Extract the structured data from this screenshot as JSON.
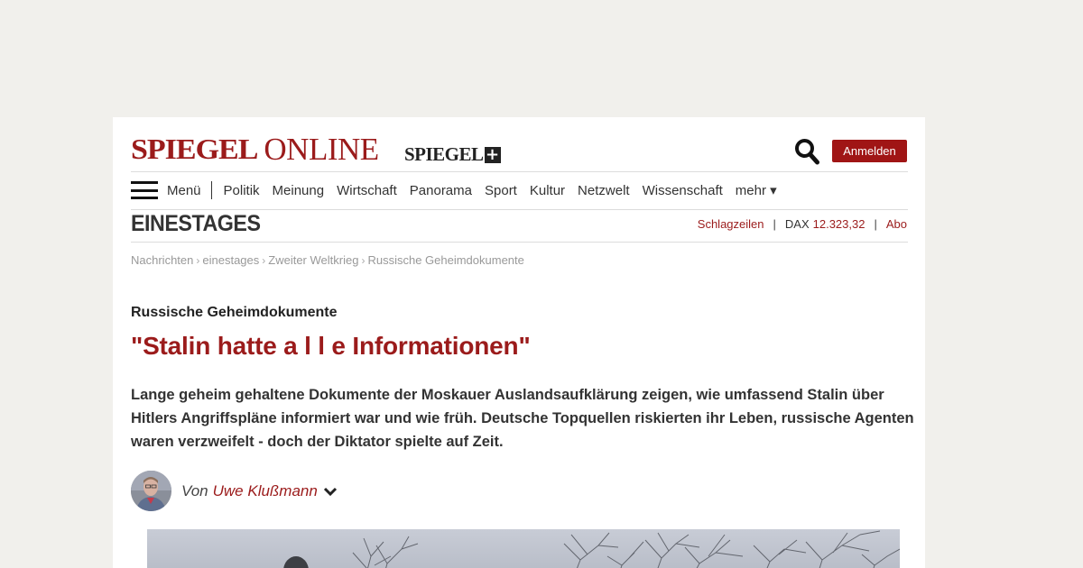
{
  "header": {
    "logo_main": "SPIEGEL",
    "logo_online": "ONLINE",
    "logo_plus": "SPIEGEL",
    "login_label": "Anmelden"
  },
  "nav": {
    "menu_label": "Menü",
    "items": [
      "Politik",
      "Meinung",
      "Wirtschaft",
      "Panorama",
      "Sport",
      "Kultur",
      "Netzwelt",
      "Wissenschaft"
    ],
    "more_label": "mehr ▾"
  },
  "section": {
    "title": "EINESTAGES",
    "headlines_label": "Schlagzeilen",
    "dax_label": "DAX",
    "dax_value": "12.323,32",
    "abo_label": "Abo"
  },
  "breadcrumb": [
    "Nachrichten",
    "einestages",
    "Zweiter Weltkrieg",
    "Russische Geheimdokumente"
  ],
  "article": {
    "kicker": "Russische Geheimdokumente",
    "headline": "\"Stalin hatte a l l e Informationen\"",
    "lead": "Lange geheim gehaltene Dokumente der Moskauer Auslandsaufklärung zeigen, wie umfassend Stalin über Hitlers Angriffspläne informiert war und wie früh. Deutsche Topquellen riskierten ihr Leben, russische Agenten waren verzweifelt - doch der Diktator spielte auf Zeit.",
    "byline_prefix": "Von",
    "author": "Uwe Klußmann"
  },
  "colors": {
    "brand": "#9b1b1b",
    "login_button": "#a01515",
    "background": "#f1f0ec"
  }
}
